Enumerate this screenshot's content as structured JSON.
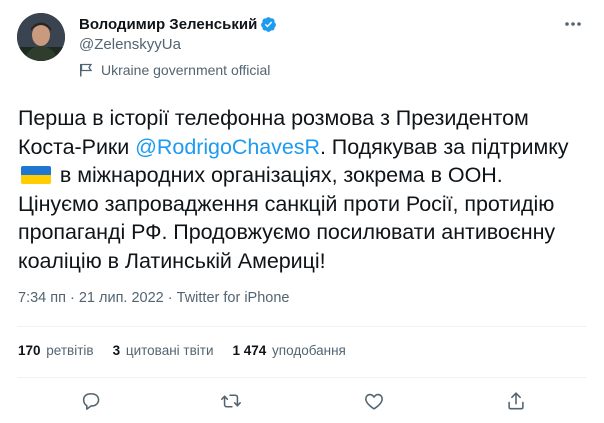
{
  "author": {
    "name": "Володимир Зеленський",
    "handle": "@ZelenskyyUa",
    "label": "Ukraine government official"
  },
  "tweet": {
    "part1": "Перша в історії телефонна розмова з Президентом Коста-Рики ",
    "mention": "@RodrigoChavesR",
    "part2": ". Подякував за підтримку ",
    "part3": " в міжнародних організаціях, зокрема в ООН. Цінуємо запровадження санкцій проти Росії, протидію пропаганді РФ. Продовжуємо посилювати антивоєнну коаліцію в Латинській Америці!"
  },
  "meta": {
    "time": "7:34 пп",
    "sep": " · ",
    "date": "21 лип. 2022",
    "source": "Twitter for iPhone"
  },
  "stats": {
    "retweets_count": "170",
    "retweets_label": "ретвітів",
    "quotes_count": "3",
    "quotes_label": "цитовані твіти",
    "likes_count": "1 474",
    "likes_label": "уподобання"
  },
  "colors": {
    "accent": "#1d9bf0",
    "flag_blue": "#1f77d1",
    "flag_yellow": "#ffcd00",
    "muted": "#536471"
  },
  "icons": [
    "verified-badge-icon",
    "flag-icon",
    "more-icon",
    "reply-icon",
    "retweet-icon",
    "like-icon",
    "share-icon"
  ]
}
